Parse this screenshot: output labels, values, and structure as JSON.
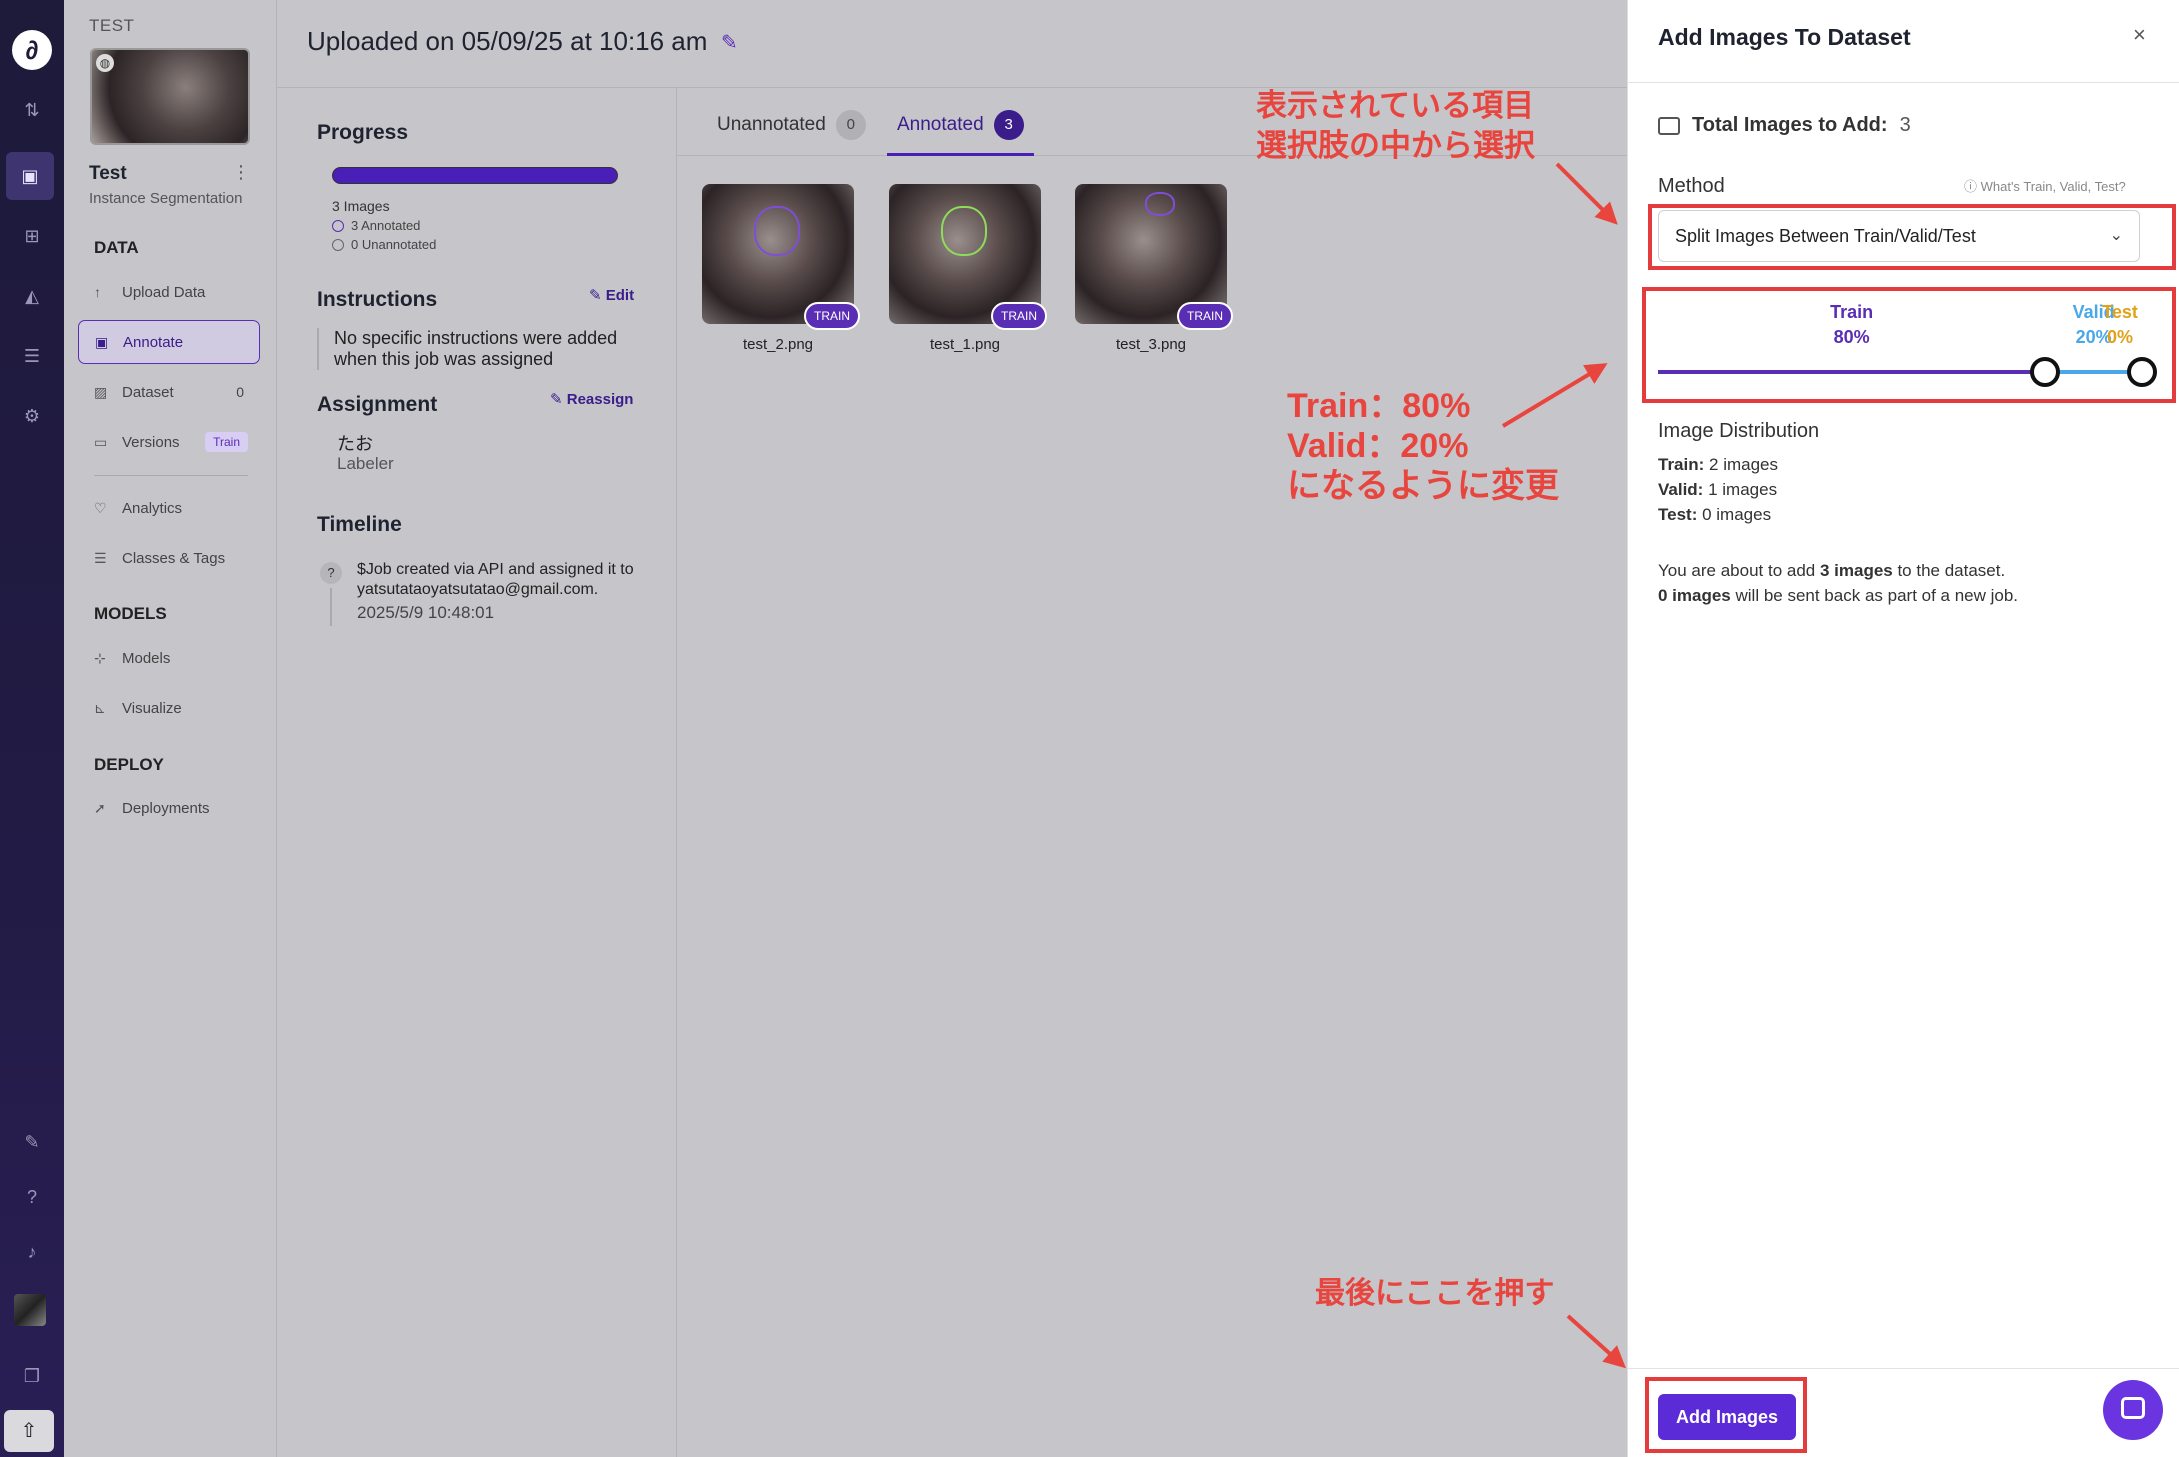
{
  "rail": {
    "logo": "∂",
    "icons": [
      "transfer-icon",
      "inbox-icon",
      "cluster-icon",
      "chart-icon",
      "stack-icon",
      "gear-icon",
      "brush-icon",
      "help-icon",
      "bell-icon",
      "avatar",
      "docs-icon",
      "upload-icon"
    ]
  },
  "project": {
    "tag": "TEST",
    "name": "Test",
    "type": "Instance Segmentation"
  },
  "nav": {
    "data_heading": "DATA",
    "upload": "Upload Data",
    "annotate": "Annotate",
    "dataset": "Dataset",
    "dataset_count": "0",
    "versions": "Versions",
    "versions_badge": "Train",
    "analytics": "Analytics",
    "classes": "Classes & Tags",
    "models_heading": "MODELS",
    "models": "Models",
    "visualize": "Visualize",
    "deploy_heading": "DEPLOY",
    "deployments": "Deployments"
  },
  "header": {
    "title": "Uploaded on 05/09/25 at 10:16 am"
  },
  "job": {
    "progress_heading": "Progress",
    "progress_fraction": 1.0,
    "images_label": "3 Images",
    "annotated_label": "3 Annotated",
    "unannotated_label": "0 Unannotated",
    "instructions_heading": "Instructions",
    "edit_label": "Edit",
    "instructions_text": "No specific instructions were added when this job was assigned",
    "assignment_heading": "Assignment",
    "reassign_label": "Reassign",
    "assignee": "たお",
    "assignee_role": "Labeler",
    "timeline_heading": "Timeline",
    "timeline_q": "?",
    "timeline_text": "$Job created via API and assigned it to yatsutataoyatsutatao@gmail.com.",
    "timeline_time": "2025/5/9 10:48:01"
  },
  "tabs": [
    {
      "label": "Unannotated",
      "count": "0"
    },
    {
      "label": "Annotated",
      "count": "3"
    }
  ],
  "images": [
    {
      "file": "test_2.png",
      "tag": "TRAIN"
    },
    {
      "file": "test_1.png",
      "tag": "TRAIN"
    },
    {
      "file": "test_3.png",
      "tag": "TRAIN"
    }
  ],
  "panel": {
    "title": "Add Images To Dataset",
    "close": "×",
    "total_label": "Total Images to Add:",
    "total_value": "3",
    "method_label": "Method",
    "whats_link": "ⓘ What's Train, Valid, Test?",
    "method_value": "Split Images Between Train/Valid/Test",
    "split": {
      "train_label": "Train",
      "train_pct": "80%",
      "train_value": 80,
      "valid_label": "Valid",
      "valid_pct": "20%",
      "valid_value": 20,
      "test_label": "Test",
      "test_pct": "0%",
      "test_value": 0
    },
    "dist_heading": "Image Distribution",
    "dist_train_k": "Train:",
    "dist_train_v": "2 images",
    "dist_valid_k": "Valid:",
    "dist_valid_v": "1 images",
    "dist_test_k": "Test:",
    "dist_test_v": "0 images",
    "summary_1a": "You are about to add ",
    "summary_1b": "3 images",
    "summary_1c": " to the dataset.",
    "summary_2a": "0 images",
    "summary_2b": " will be sent back as part of a new job.",
    "add_button": "Add Images"
  },
  "annotations": {
    "a1_line1": "表示されている項目",
    "a1_line2": "選択肢の中から選択",
    "a2_line1": "Train：80%",
    "a2_line2": "Valid：20%",
    "a2_line3": "になるように変更",
    "a3": "最後にここを押す"
  },
  "colors": {
    "accent": "#5a2bd6",
    "train": "#5a2db5",
    "valid": "#4aa8e8",
    "test": "#e0a21b",
    "annotation_red": "#e43c3c"
  }
}
